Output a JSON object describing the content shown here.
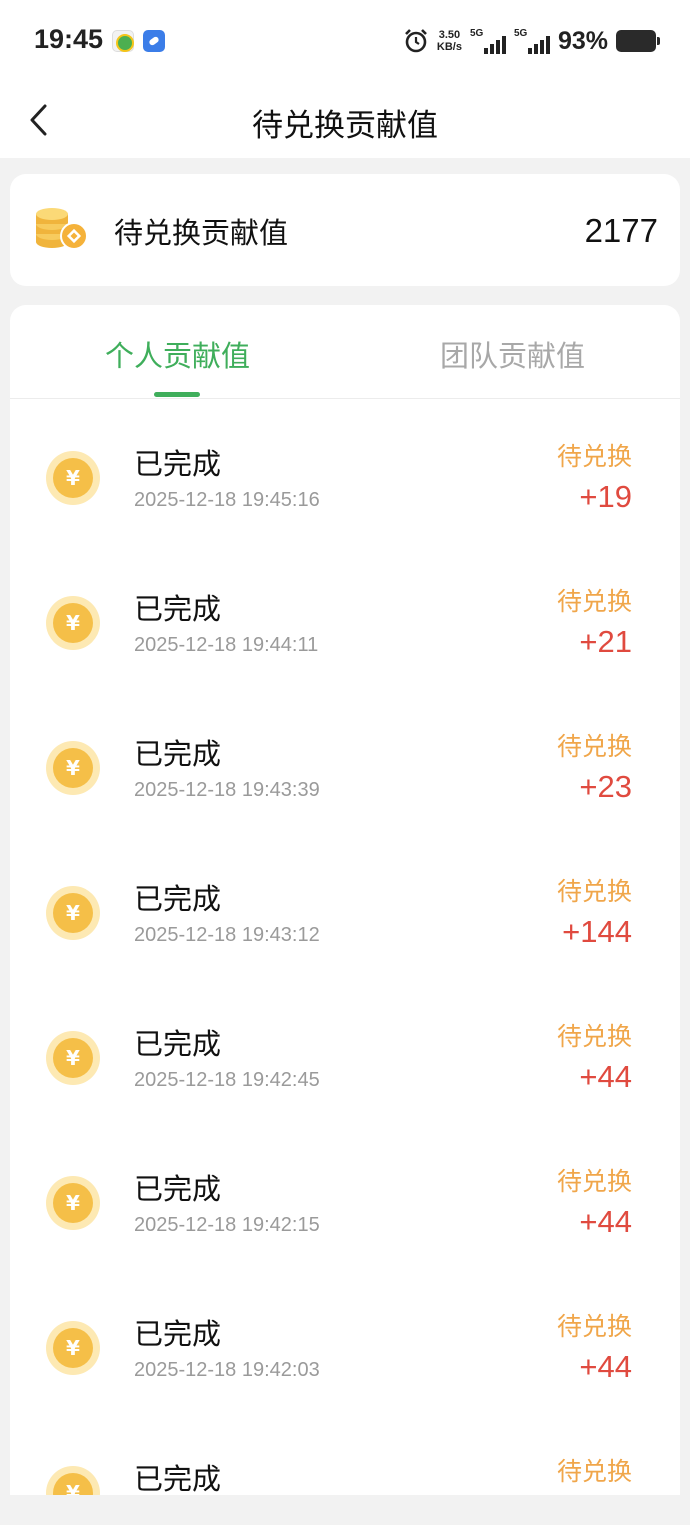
{
  "status_bar": {
    "time": "19:45",
    "net_speed_value": "3.50",
    "net_speed_unit": "KB/s",
    "signal_1": "5G",
    "signal_2": "5G",
    "battery": "93%"
  },
  "header": {
    "title": "待兑换贡献值"
  },
  "summary": {
    "label": "待兑换贡献值",
    "value": "2177"
  },
  "tabs": [
    {
      "label": "个人贡献值",
      "active": true
    },
    {
      "label": "团队贡献值",
      "active": false
    }
  ],
  "records": [
    {
      "icon": "yen-coin-icon",
      "status": "已完成",
      "time": "2025-12-18 19:45:16",
      "state": "待兑换",
      "amount": "+19"
    },
    {
      "icon": "yen-coin-icon",
      "status": "已完成",
      "time": "2025-12-18 19:44:11",
      "state": "待兑换",
      "amount": "+21"
    },
    {
      "icon": "yen-coin-icon",
      "status": "已完成",
      "time": "2025-12-18 19:43:39",
      "state": "待兑换",
      "amount": "+23"
    },
    {
      "icon": "yen-coin-icon",
      "status": "已完成",
      "time": "2025-12-18 19:43:12",
      "state": "待兑换",
      "amount": "+144"
    },
    {
      "icon": "yen-coin-icon",
      "status": "已完成",
      "time": "2025-12-18 19:42:45",
      "state": "待兑换",
      "amount": "+44"
    },
    {
      "icon": "yen-coin-icon",
      "status": "已完成",
      "time": "2025-12-18 19:42:15",
      "state": "待兑换",
      "amount": "+44"
    },
    {
      "icon": "yen-coin-icon",
      "status": "已完成",
      "time": "2025-12-18 19:42:03",
      "state": "待兑换",
      "amount": "+44"
    },
    {
      "icon": "yen-coin-icon",
      "status": "已完成",
      "time": "",
      "state": "待兑换",
      "amount": ""
    }
  ],
  "colors": {
    "accent_green": "#3fae5b",
    "state_orange": "#f0a64a",
    "amount_red": "#e04a3f",
    "coin_gold": "#f5bf48"
  }
}
